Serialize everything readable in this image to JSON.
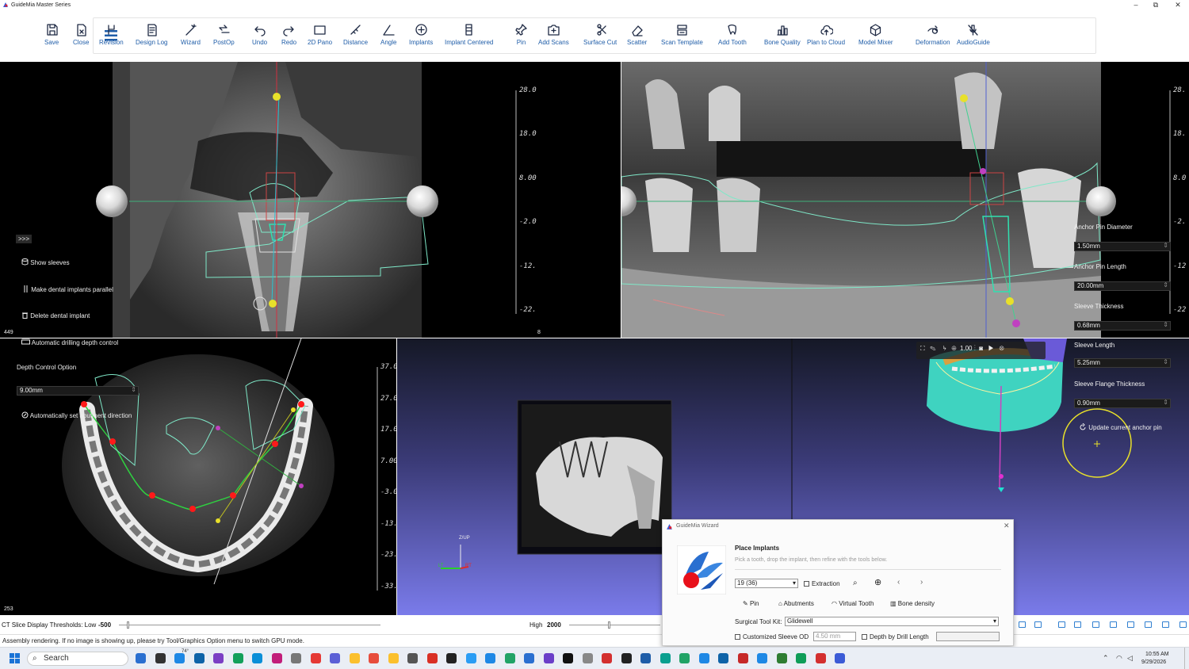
{
  "window": {
    "title": "GuideMia Master Series",
    "minimize": "–",
    "maximize": "⧉",
    "close": "✕"
  },
  "toolbar": {
    "buttons": [
      {
        "label": "Save",
        "icon": "save-icon"
      },
      {
        "label": "Close",
        "icon": "close-file-icon"
      },
      {
        "label": "Revision",
        "icon": "revision-icon"
      },
      {
        "label": "Design Log",
        "icon": "design-log-icon"
      },
      {
        "label": "Wizard",
        "icon": "wizard-wand-icon"
      },
      {
        "label": "PostOp",
        "icon": "postop-icon"
      },
      {
        "label": "Undo",
        "icon": "undo-icon"
      },
      {
        "label": "Redo",
        "icon": "redo-icon"
      },
      {
        "label": "2D Pano",
        "icon": "pano-icon"
      },
      {
        "label": "Distance",
        "icon": "ruler-icon"
      },
      {
        "label": "Angle",
        "icon": "angle-icon"
      },
      {
        "label": "Implants",
        "icon": "implant-plus-icon"
      },
      {
        "label": "Implant Centered",
        "icon": "implant-centered-icon"
      },
      {
        "label": "Pin",
        "icon": "pin-icon"
      },
      {
        "label": "Add Scans",
        "icon": "camera-add-icon"
      },
      {
        "label": "Surface Cut",
        "icon": "scissors-icon"
      },
      {
        "label": "Scatter",
        "icon": "eraser-icon"
      },
      {
        "label": "Scan Template",
        "icon": "scan-template-icon"
      },
      {
        "label": "Add Tooth",
        "icon": "tooth-icon"
      },
      {
        "label": "Bone Quality",
        "icon": "bar-chart-icon"
      },
      {
        "label": "Plan to Cloud",
        "icon": "cloud-upload-icon"
      },
      {
        "label": "Model Mixer",
        "icon": "cube-icon"
      },
      {
        "label": "Deformation",
        "icon": "deformation-icon"
      },
      {
        "label": "AudioGuide",
        "icon": "mic-off-icon"
      }
    ]
  },
  "sagittal": {
    "scale": [
      "28.0",
      "18.0",
      "8.00",
      "-2.0",
      "-12.",
      "-22."
    ],
    "corner_num": "449",
    "expand": ">>>",
    "options": {
      "show_sleeves": "Show sleeves",
      "parallel": "Make dental implants parallel",
      "delete": "Delete dental implant",
      "auto_depth": "Automatic drilling depth control",
      "depth_option": "Depth Control Option",
      "depth_value": "9.00mm",
      "auto_abut": "Automatically set abutment direction"
    }
  },
  "panoramic": {
    "scale": [
      "28.",
      "18.",
      "8.0",
      "-2.",
      "-12",
      "-22"
    ],
    "corner_num": "8",
    "anchor": {
      "pin_diameter_label": "Anchor Pin Diameter",
      "pin_diameter": "1.50mm",
      "pin_length_label": "Anchor Pin Length",
      "pin_length": "20.00mm",
      "sleeve_thickness_label": "Sleeve Thickness",
      "sleeve_thickness": "0.68mm",
      "sleeve_length_label": "Sleeve Length",
      "sleeve_length": "5.25mm",
      "flange_label": "Sleeve Flange Thickness",
      "flange": "0.90mm",
      "update_label": "Update current anchor pin"
    }
  },
  "axial": {
    "scale": [
      "37.0",
      "27.0",
      "17.0",
      "7.00",
      "-3.0",
      "-13.",
      "-23.",
      "-33."
    ],
    "corner_num": "253"
  },
  "view3d": {
    "axis_up": "Z/UP",
    "axis_lt": "LT",
    "axis_rt": "RT",
    "zoom": "1.00"
  },
  "threshold": {
    "label": "CT Slice Display Thresholds: Low",
    "low": "-500",
    "high_label": "High",
    "high": "2000"
  },
  "status": {
    "message": "Assembly rendering. If no image is showing up, please try Tool/Graphics Option menu to switch GPU mode."
  },
  "wizard": {
    "title": "GuideMia Wizard",
    "heading": "Place Implants",
    "desc": "Pick a tooth, drop the implant, then refine with the tools below.",
    "tooth": "19  (36)",
    "extraction": "Extraction",
    "pin": "Pin",
    "abutments": "Abutments",
    "virtual_tooth": "Virtual Tooth",
    "bone_density": "Bone density",
    "kit_label": "Surgical Tool Kit:",
    "kit": "Glidewell",
    "sleeve_od_label": "Customized Sleeve OD",
    "sleeve_od": "4.50 mm",
    "depth_label": "Depth by Drill Length"
  },
  "taskbar": {
    "search": "Search",
    "temp": "74°",
    "time": "10:55 AM",
    "date": "9/29/2026"
  }
}
